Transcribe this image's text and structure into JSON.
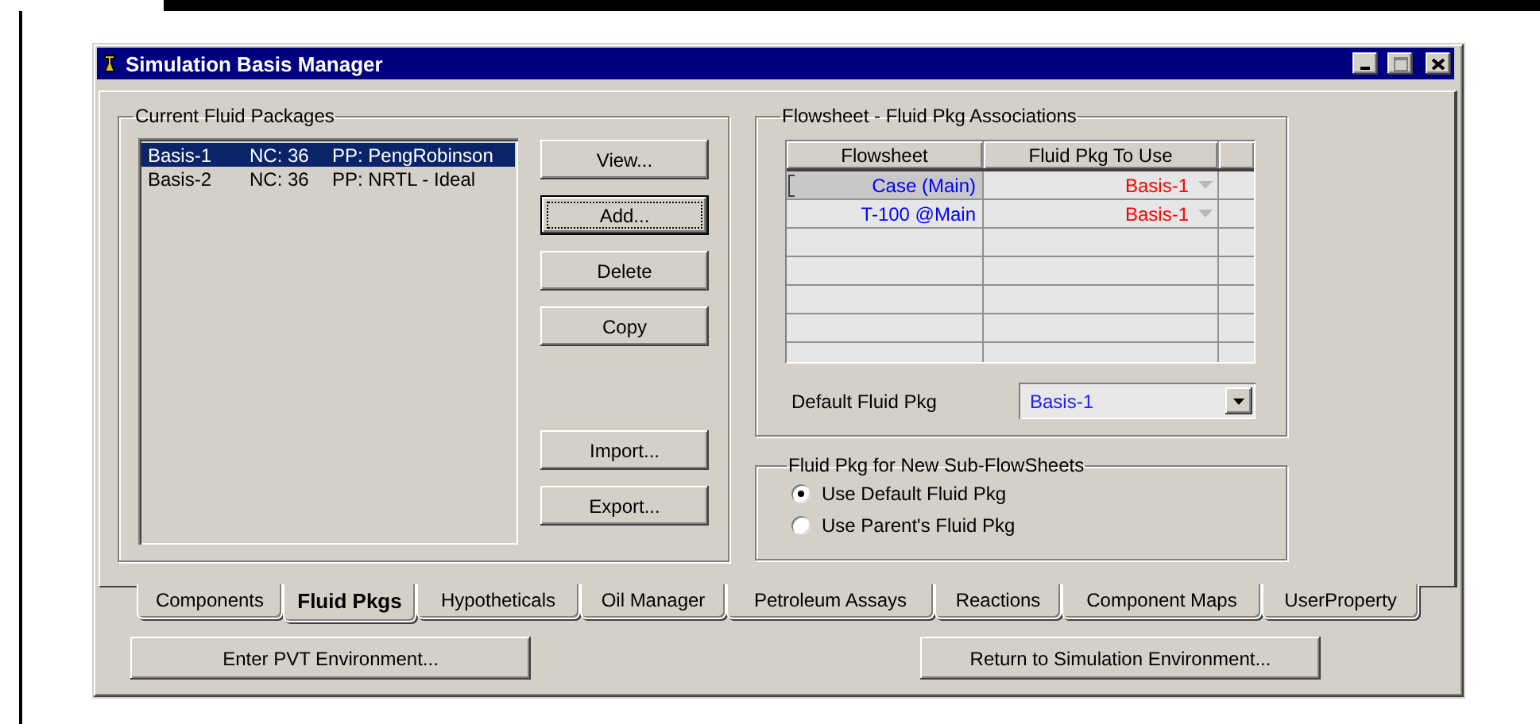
{
  "window": {
    "title": "Simulation Basis Manager"
  },
  "fluid_packages": {
    "label": "Current Fluid Packages",
    "items": [
      {
        "name": "Basis-1",
        "nc": "NC: 36",
        "pp": "PP: PengRobinson",
        "selected": true
      },
      {
        "name": "Basis-2",
        "nc": "NC: 36",
        "pp": "PP: NRTL - Ideal",
        "selected": false
      }
    ]
  },
  "edit_buttons": [
    {
      "label": "View...",
      "focused": false
    },
    {
      "label": "Add...",
      "focused": true
    },
    {
      "label": "Delete",
      "focused": false
    },
    {
      "label": "Copy",
      "focused": false
    }
  ],
  "transfer_buttons": [
    {
      "label": "Import...",
      "focused": false
    },
    {
      "label": "Export...",
      "focused": false
    }
  ],
  "associations": {
    "label": "Flowsheet - Fluid Pkg Associations",
    "columns": [
      "Flowsheet",
      "Fluid Pkg To Use"
    ],
    "rows": [
      {
        "flowsheet": "Case (Main)",
        "fluid_pkg": "Basis-1",
        "selected": true
      },
      {
        "flowsheet": "T-100 @Main",
        "fluid_pkg": "Basis-1",
        "selected": false
      }
    ],
    "default_fluid_pkg": {
      "label": "Default Fluid Pkg",
      "value": "Basis-1"
    }
  },
  "sub_flowsheets": {
    "label": "Fluid Pkg for New Sub-FlowSheets",
    "options": [
      {
        "label": "Use Default Fluid Pkg",
        "selected": true
      },
      {
        "label": "Use Parent's Fluid Pkg",
        "selected": false
      }
    ]
  },
  "tabs": [
    {
      "label": "Components",
      "selected": false
    },
    {
      "label": "Fluid Pkgs",
      "selected": true
    },
    {
      "label": "Hypotheticals",
      "selected": false
    },
    {
      "label": "Oil Manager",
      "selected": false
    },
    {
      "label": "Petroleum Assays",
      "selected": false
    },
    {
      "label": "Reactions",
      "selected": false
    },
    {
      "label": "Component Maps",
      "selected": false
    },
    {
      "label": "UserProperty",
      "selected": false
    }
  ],
  "bottom_buttons": [
    "Enter PVT Environment...",
    "Return to Simulation Environment..."
  ]
}
